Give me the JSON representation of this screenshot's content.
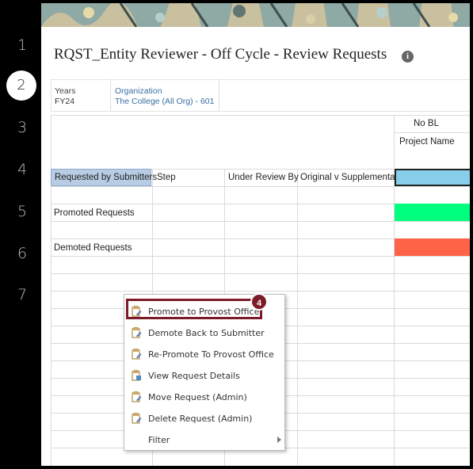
{
  "steps": [
    "1",
    "2",
    "3",
    "4",
    "5",
    "6",
    "7"
  ],
  "page": {
    "title": "RQST_Entity Reviewer - Off Cycle - Review Requests"
  },
  "pov": {
    "years_label": "Years",
    "years_value": "FY24",
    "org_label": "Organization",
    "org_value": "The College (All Org) - 601"
  },
  "grid": {
    "col_group_header": "No BL",
    "col_project_name": "Project Name",
    "col_headers": [
      "Requested by Submitters",
      "Step",
      "Under Review By",
      "Original v Supplemental"
    ],
    "rows": [
      "Promoted Requests",
      "Demoted Requests"
    ],
    "status_colors": {
      "requested": "#87ceeb",
      "promoted": "#00ff7f",
      "demoted": "#ff6347"
    }
  },
  "context_menu": {
    "items": [
      {
        "label": "Promote to Provost Office",
        "icon": "promote-icon"
      },
      {
        "label": "Demote Back to Submitter",
        "icon": "demote-icon"
      },
      {
        "label": "Re-Promote To Provost Office",
        "icon": "repromote-icon"
      },
      {
        "label": "View Request Details",
        "icon": "view-details-icon"
      },
      {
        "label": "Move Request (Admin)",
        "icon": "move-icon"
      },
      {
        "label": "Delete Request (Admin)",
        "icon": "delete-icon"
      },
      {
        "label": "Filter",
        "icon": "submenu-arrow-icon"
      }
    ]
  },
  "callout": {
    "number": "4"
  }
}
